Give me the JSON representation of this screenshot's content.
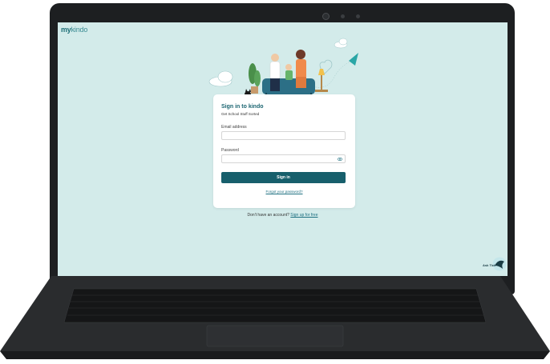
{
  "app": {
    "logo_prefix": "my",
    "logo_suffix": "kindo"
  },
  "signin": {
    "title": "Sign in to kindo",
    "subtitle": "Get School Stuff Sorted",
    "email_label": "Email address",
    "password_label": "Password",
    "button_label": "Sign in",
    "forgot_label": "Forgot your password?"
  },
  "signup": {
    "prompt": "Don't have an account?",
    "link": "Sign up for free"
  },
  "help": {
    "ask_label": "Ask Tick"
  },
  "colors": {
    "screen_bg": "#d3ebea",
    "brand_teal": "#175f6c",
    "link_teal": "#1d6f80",
    "laptop_body": "#1d1f21"
  },
  "icons": [
    "eye-icon",
    "cloud-icon",
    "paper-plane-icon",
    "heart-icon",
    "cat-icon",
    "plant-icon",
    "lamp-icon",
    "ask-tick-icon"
  ]
}
